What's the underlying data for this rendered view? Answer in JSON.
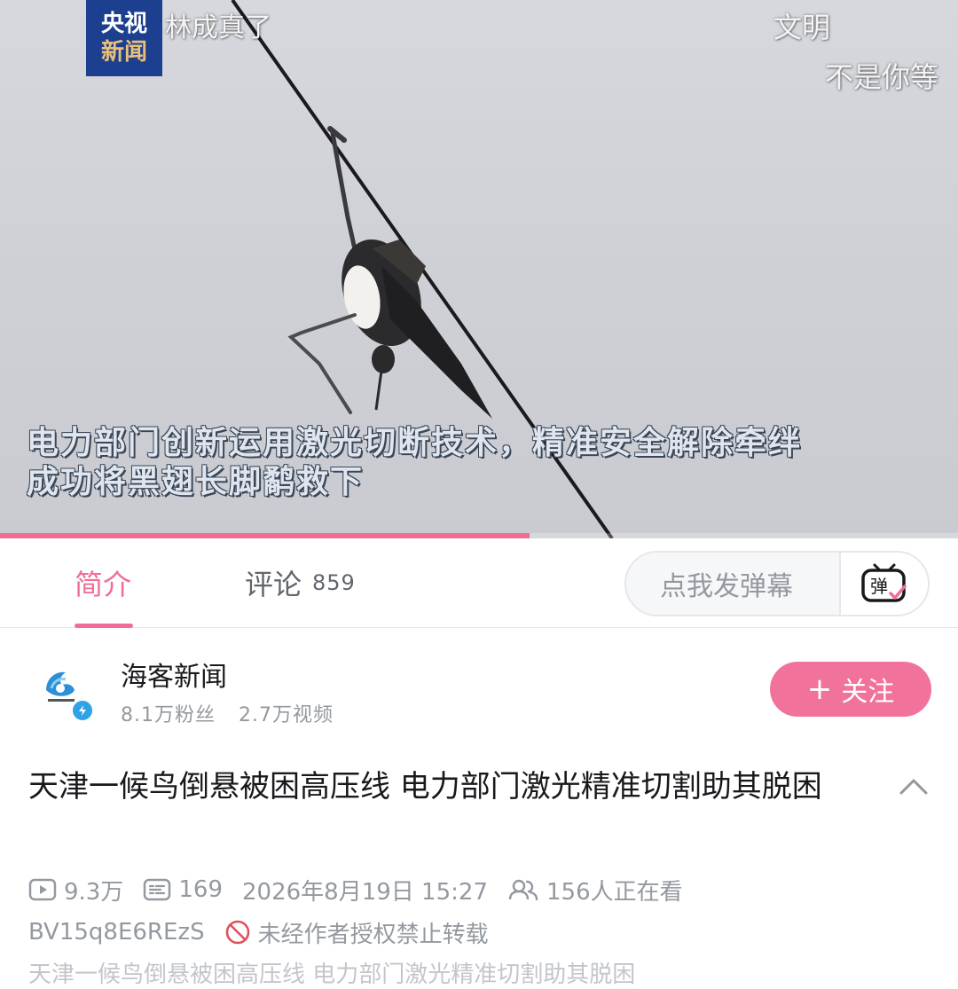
{
  "video": {
    "channel_logo": [
      "央视",
      "新闻"
    ],
    "overlay_texts": [
      "林成真了",
      "文明",
      "不是你等"
    ],
    "subtitle_lines": [
      "电力部门创新运用激光切断技术，精准安全解除牵绊",
      "成功将黑翅长脚鹬救下"
    ],
    "progress": 0.553,
    "accent_color": "#f06e95"
  },
  "tabs": {
    "intro_label": "简介",
    "comments_label": "评论",
    "comments_count": "859"
  },
  "danmaku": {
    "placeholder": "点我发弹幕",
    "toggle_icon": "danmaku-icon",
    "toggle_glyph": "弹"
  },
  "uploader": {
    "name": "海客新闻",
    "fans": "8.1万粉丝",
    "videos": "2.7万视频",
    "follow_label": "关注",
    "follow_icon": "plus-icon",
    "follow_color": "#f1729a"
  },
  "title": "天津一候鸟倒悬被困高压线 电力部门激光精准切割助其脱困",
  "meta": {
    "views": "9.3万",
    "danmaku_count": "169",
    "publish_time": "2026年8月19日 15:27",
    "watching": "156人正在看",
    "bvid": "BV15q8E6REzS",
    "copyright_notice": "未经作者授权禁止转载"
  },
  "description_preview": "天津一候鸟倒悬被困高压线 电力部门激光精准切割助其脱困"
}
